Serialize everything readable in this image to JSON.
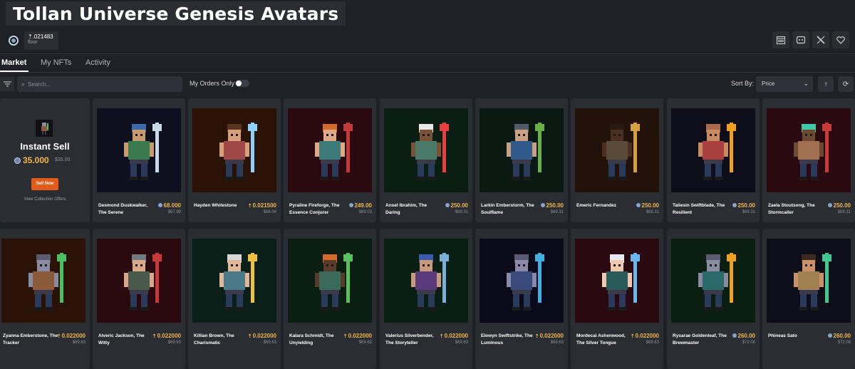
{
  "header": {
    "title": "Tollan Universe Genesis Avatars",
    "floor_value": "⇡.021483",
    "floor_label": "floor",
    "icons": [
      "website-icon",
      "discord-icon",
      "x-icon",
      "heart-icon"
    ]
  },
  "tabs": [
    {
      "label": "Market",
      "active": true
    },
    {
      "label": "My NFTs",
      "active": false
    },
    {
      "label": "Activity",
      "active": false
    }
  ],
  "toolbar": {
    "search_placeholder": "Search...",
    "my_orders_label": "My Orders Only",
    "my_orders_on": false,
    "sort_label": "Sort By:",
    "sort_value": "Price"
  },
  "instant_sell": {
    "title": "Instant Sell",
    "price": "35.000",
    "price_usd": "$35.00",
    "button": "Sell Now",
    "link": "View Collection Offers"
  },
  "colors": {
    "accent": "#e25b18",
    "price": "#f0b44a",
    "background": "#1e2227",
    "card": "#2a2e33"
  },
  "cards": [
    {
      "name": "Desmond Duskwalker, The Serene",
      "price": "68.000",
      "usd": "$67.99",
      "currency": "coin",
      "bg": "#0e1020",
      "skin": "#c99a6e",
      "hair": "#3a6aa8",
      "shirt": "#3b7a4e",
      "weapon": "#c9d8e6"
    },
    {
      "name": "Hayden Whitestone",
      "price": "0.021500",
      "usd": "$68.04",
      "currency": "eth",
      "bg": "#2a1206",
      "skin": "#d6a07a",
      "hair": "#5a3420",
      "shirt": "#a04848",
      "weapon": "#8fd0ff"
    },
    {
      "name": "Pyraline Fireforge, The Essence Conjurer",
      "price": "249.00",
      "usd": "$69.03",
      "currency": "coin",
      "bg": "#2a0a0e",
      "skin": "#e0a884",
      "hair": "#d46a2a",
      "shirt": "#3d7a7a",
      "weapon": "#c23a3a"
    },
    {
      "name": "Ansel Ibrahim, The Daring",
      "price": "250.00",
      "usd": "$69.31",
      "currency": "coin",
      "bg": "#0a1f12",
      "skin": "#7a5238",
      "hair": "#e8e8e8",
      "shirt": "#4a7a6a",
      "weapon": "#e84040"
    },
    {
      "name": "Larkin Emberstorm, The Soulflame",
      "price": "250.00",
      "usd": "$69.31",
      "currency": "coin",
      "bg": "#0a1a12",
      "skin": "#c9a084",
      "hair": "#505a68",
      "shirt": "#2f5a8a",
      "weapon": "#6ab04a"
    },
    {
      "name": "Emeric Fernandez",
      "price": "250.00",
      "usd": "$69.31",
      "currency": "coin",
      "bg": "#22120a",
      "skin": "#4a3020",
      "hair": "#2a1a12",
      "shirt": "#5a4a3a",
      "weapon": "#d4a040"
    },
    {
      "name": "Taliesin Swiftblade, The Resilient",
      "price": "250.00",
      "usd": "$69.31",
      "currency": "coin",
      "bg": "#0e0e1a",
      "skin": "#c98a60",
      "hair": "#a86a4a",
      "shirt": "#a84040",
      "weapon": "#f0a020"
    },
    {
      "name": "Zaela Stoutsong, The Stormcaller",
      "price": "250.00",
      "usd": "$69.31",
      "currency": "coin",
      "bg": "#2a0a10",
      "skin": "#6a4a30",
      "hair": "#40c8a8",
      "shirt": "#a07050",
      "weapon": "#c83a3a"
    },
    {
      "name": "Zyanna Emberstone, The Tracker",
      "price": "0.022000",
      "usd": "$69.63",
      "currency": "eth",
      "bg": "#2a1206",
      "skin": "#8a8aa0",
      "hair": "#5a5a70",
      "shirt": "#8a5a3a",
      "weapon": "#4ac060"
    },
    {
      "name": "Alveric Jackson, The Witty",
      "price": "0.022000",
      "usd": "$69.63",
      "currency": "eth",
      "bg": "#2a0a0e",
      "skin": "#d8a888",
      "hair": "#707880",
      "shirt": "#4a5a4a",
      "weapon": "#c83a3a"
    },
    {
      "name": "Killian Brown, The Charismatic",
      "price": "0.022000",
      "usd": "$69.63",
      "currency": "eth",
      "bg": "#0a1f18",
      "skin": "#e0b898",
      "hair": "#d8d8d8",
      "shirt": "#4a7a8a",
      "weapon": "#f0c040"
    },
    {
      "name": "Kalara Schmidt, The Unyielding",
      "price": "0.022000",
      "usd": "$69.63",
      "currency": "eth",
      "bg": "#0a1f12",
      "skin": "#5a3a28",
      "hair": "#d46a2a",
      "shirt": "#3a6a5a",
      "weapon": "#5ac060"
    },
    {
      "name": "Valerius Silverbender, The Storyteller",
      "price": "0.022000",
      "usd": "$69.63",
      "currency": "eth",
      "bg": "#0a1f14",
      "skin": "#c99a7a",
      "hair": "#3a5ab0",
      "shirt": "#5a3a7a",
      "weapon": "#7ab0d8"
    },
    {
      "name": "Elowyn Swiftstrike, The Luminous",
      "price": "0.022000",
      "usd": "$69.63",
      "currency": "eth",
      "bg": "#0a0a1a",
      "skin": "#8a8aa8",
      "hair": "#5a5a70",
      "shirt": "#3a4a7a",
      "weapon": "#40b0e0"
    },
    {
      "name": "Mordecai Ashenwood, The Silver Tongue",
      "price": "0.022000",
      "usd": "$69.63",
      "currency": "eth",
      "bg": "#2a0a10",
      "skin": "#f0c8b0",
      "hair": "#e8e8f0",
      "shirt": "#2a5a5a",
      "weapon": "#6ab8f0"
    },
    {
      "name": "Rysarae Goldenleaf, The Brewmaster",
      "price": "260.00",
      "usd": "$72.08",
      "currency": "coin",
      "bg": "#0a1f12",
      "skin": "#8a8aa0",
      "hair": "#5a5a70",
      "shirt": "#2a6a6a",
      "weapon": "#f0a020"
    },
    {
      "name": "Phineas Sato",
      "price": "260.00",
      "usd": "$72.08",
      "currency": "coin",
      "bg": "#0e0e1a",
      "skin": "#c9906a",
      "hair": "#3a2a20",
      "shirt": "#a08050",
      "weapon": "#40c890"
    }
  ]
}
